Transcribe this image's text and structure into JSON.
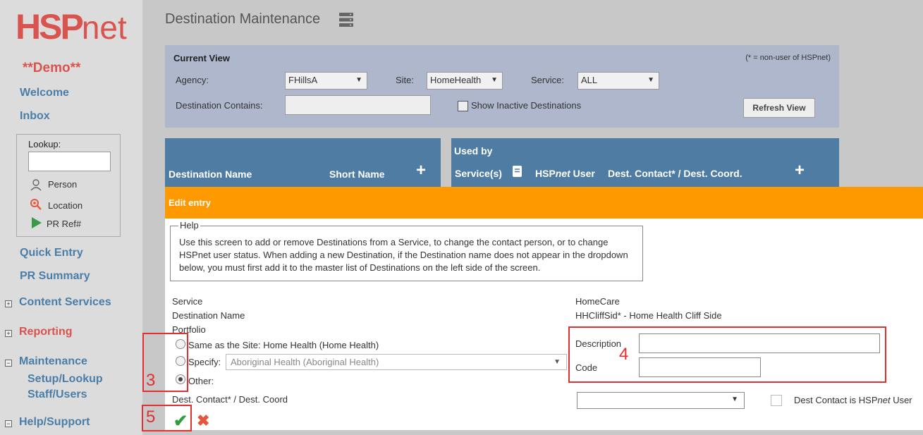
{
  "sidebar": {
    "logo_hsp": "HSP",
    "logo_net": "net",
    "demo": "**Demo**",
    "welcome": "Welcome",
    "inbox": "Inbox",
    "lookup": {
      "label": "Lookup:",
      "person": "Person",
      "location": "Location",
      "pr_ref": "PR Ref#"
    },
    "quick_entry": "Quick Entry",
    "pr_summary": "PR Summary",
    "content_services": "Content Services",
    "reporting": "Reporting",
    "maintenance": "Maintenance",
    "setup_lookup": "Setup/Lookup",
    "staff_users": "Staff/Users",
    "help_support": "Help/Support"
  },
  "header": {
    "title": "Destination Maintenance"
  },
  "current_view": {
    "title": "Current View",
    "note": "(* = non-user of HSPnet)",
    "agency_label": "Agency:",
    "agency_value": "FHillsA",
    "site_label": "Site:",
    "site_value": "HomeHealth",
    "service_label": "Service:",
    "service_value": "ALL",
    "dest_contains_label": "Destination Contains:",
    "dest_contains_value": "",
    "show_inactive": "Show Inactive Destinations",
    "refresh": "Refresh View"
  },
  "table_headers": {
    "destination_name": "Destination Name",
    "short_name": "Short Name",
    "used_by": "Used by",
    "services": "Service(s)",
    "hspnet_user_a": "HSP",
    "hspnet_user_b": "net",
    "hspnet_user_c": " User",
    "dest_contact": "Dest. Contact* / Dest. Coord."
  },
  "edit": {
    "title": "Edit entry",
    "help_legend": "Help",
    "help_text": "Use this screen to add or remove Destinations from a Service, to change the contact person, or to change HSPnet user status. When adding a new Destination, if the Destination name does not appear in the dropdown below, you must first add it to the master list of Destinations on the left side of the screen.",
    "service_label": "Service",
    "service_value": "HomeCare",
    "dest_name_label": "Destination Name",
    "dest_name_value": "HHCliffSid* - Home Health Cliff Side",
    "portfolio_label": "Portfolio",
    "opt_same": "Same as the Site: Home Health (Home Health)",
    "opt_specify": "Specify:",
    "specify_value": "Aboriginal Health (Aboriginal Health)",
    "opt_other": "Other:",
    "description_label": "Description",
    "description_value": "",
    "code_label": "Code",
    "code_value": "",
    "dest_contact_label": "Dest. Contact* / Dest. Coord",
    "dest_contact_value": "",
    "dest_hspnet_a": "Dest Contact is HSP",
    "dest_hspnet_b": "net",
    "dest_hspnet_c": " User",
    "selected_option": "other"
  },
  "annotations": {
    "n3": "3",
    "n4": "4",
    "n5": "5"
  },
  "colors": {
    "brand_red": "#d9534f",
    "nav_blue": "#4a7ea8",
    "header_blue": "#4f7ca3",
    "edit_orange": "#ff9900",
    "annotation_red": "#e03030"
  }
}
